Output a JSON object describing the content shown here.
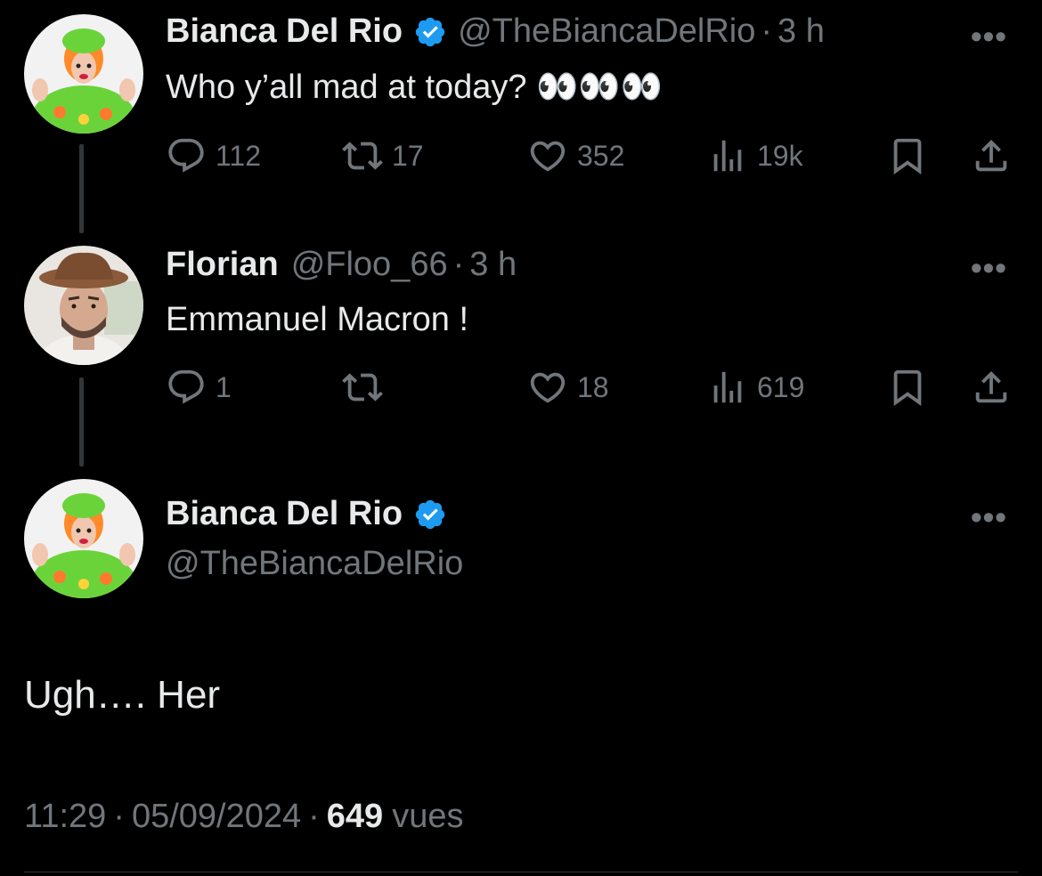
{
  "tweets": [
    {
      "name": "Bianca Del Rio",
      "handle": "@TheBiancaDelRio",
      "time": "3 h",
      "text": "Who y’all mad at today? 👀👀👀",
      "counts": {
        "reply": "112",
        "retweet": "17",
        "like": "352",
        "views": "19k"
      }
    },
    {
      "name": "Florian",
      "handle": "@Floo_66",
      "time": "3 h",
      "text": "Emmanuel Macron !",
      "counts": {
        "reply": "1",
        "retweet": "",
        "like": "18",
        "views": "619"
      }
    }
  ],
  "main": {
    "name": "Bianca Del Rio",
    "handle": "@TheBiancaDelRio",
    "text": "Ugh…. Her",
    "time": "11:29",
    "date": "05/09/2024",
    "views_count": "649",
    "views_label": "vues"
  },
  "separator": "·",
  "more_glyph": "•••",
  "colors": {
    "verified": "#1d9bf0",
    "background": "#000000",
    "secondary": "#71767b"
  }
}
